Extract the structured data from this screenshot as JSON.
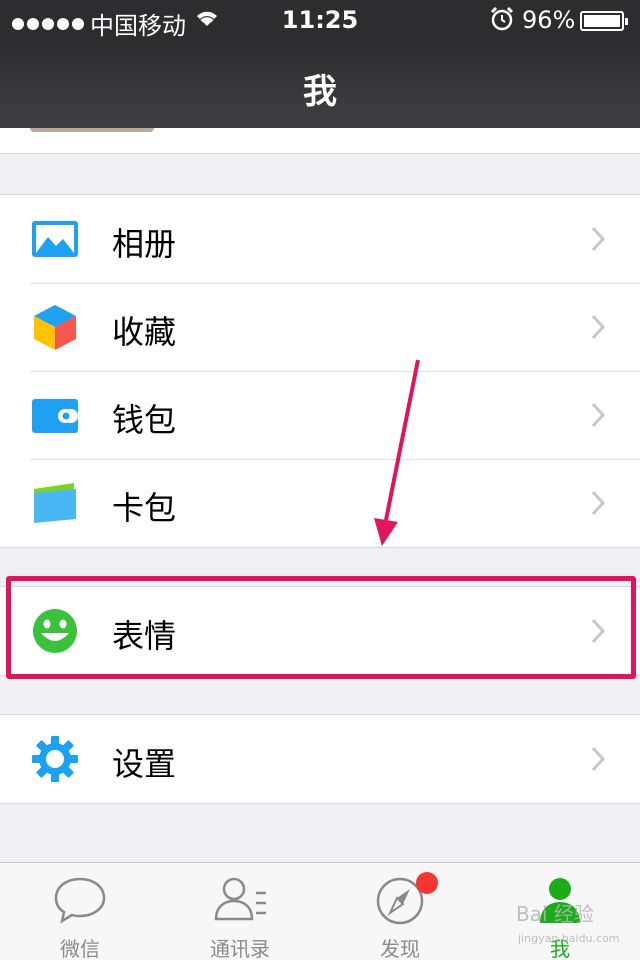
{
  "status_bar": {
    "carrier": "中国移动",
    "time": "11:25",
    "battery": "96%"
  },
  "header": {
    "title": "我"
  },
  "menu_groups": [
    {
      "items": [
        {
          "label": "相册",
          "icon": "photo-album-icon"
        },
        {
          "label": "收藏",
          "icon": "favorites-cube-icon"
        },
        {
          "label": "钱包",
          "icon": "wallet-icon"
        },
        {
          "label": "卡包",
          "icon": "card-pack-icon"
        }
      ]
    },
    {
      "items": [
        {
          "label": "表情",
          "icon": "smiley-face-icon"
        }
      ]
    },
    {
      "items": [
        {
          "label": "设置",
          "icon": "settings-gear-icon"
        }
      ]
    }
  ],
  "tab_bar": {
    "tabs": [
      {
        "label": "微信",
        "icon": "chat-bubble-icon"
      },
      {
        "label": "通讯录",
        "icon": "contacts-icon"
      },
      {
        "label": "发现",
        "icon": "compass-icon"
      },
      {
        "label": "我",
        "icon": "profile-icon"
      }
    ],
    "active_index": 3
  },
  "watermark": {
    "text": "Bai 经验",
    "sub": "jingyan.baidu.com"
  },
  "colors": {
    "accent_green": "#1aad19",
    "highlight_pink": "#e0155e",
    "icon_blue": "#1ea1f3",
    "badge_red": "#f43530"
  }
}
